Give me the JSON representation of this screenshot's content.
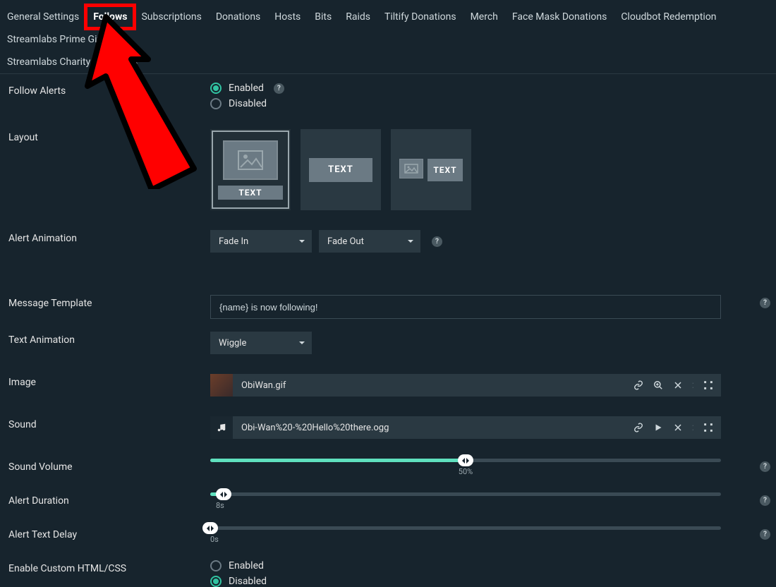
{
  "tabs": {
    "row1": [
      "General Settings",
      "Follows",
      "Subscriptions",
      "Donations",
      "Hosts",
      "Bits",
      "Raids",
      "Tiltify Donations",
      "Merch",
      "Face Mask Donations",
      "Cloudbot Redemption",
      "Streamlabs Prime Gift"
    ],
    "row2": [
      "Streamlabs Charity Donations"
    ],
    "active": "Follows"
  },
  "labels": {
    "followAlerts": "Follow Alerts",
    "layout": "Layout",
    "alertAnimation": "Alert Animation",
    "messageTemplate": "Message Template",
    "textAnimation": "Text Animation",
    "image": "Image",
    "sound": "Sound",
    "soundVolume": "Sound Volume",
    "alertDuration": "Alert Duration",
    "alertTextDelay": "Alert Text Delay",
    "enableCustomHtml": "Enable Custom HTML/CSS"
  },
  "radio": {
    "enabled": "Enabled",
    "disabled": "Disabled"
  },
  "layoutText": "TEXT",
  "animation": {
    "in": "Fade In",
    "out": "Fade Out"
  },
  "messageTemplate": "{name} is now following!",
  "textAnimation": "Wiggle",
  "image": {
    "name": "ObiWan.gif"
  },
  "sound": {
    "name": "Obi-Wan%20-%20Hello%20there.ogg"
  },
  "soundVolume": {
    "percent": 50,
    "label": "50%"
  },
  "alertDuration": {
    "seconds": 8,
    "label": "8s",
    "maxSeconds": 300
  },
  "alertTextDelay": {
    "seconds": 0,
    "label": "0s",
    "maxSeconds": 300
  },
  "customHtml": {
    "value": "disabled"
  },
  "help": "?"
}
